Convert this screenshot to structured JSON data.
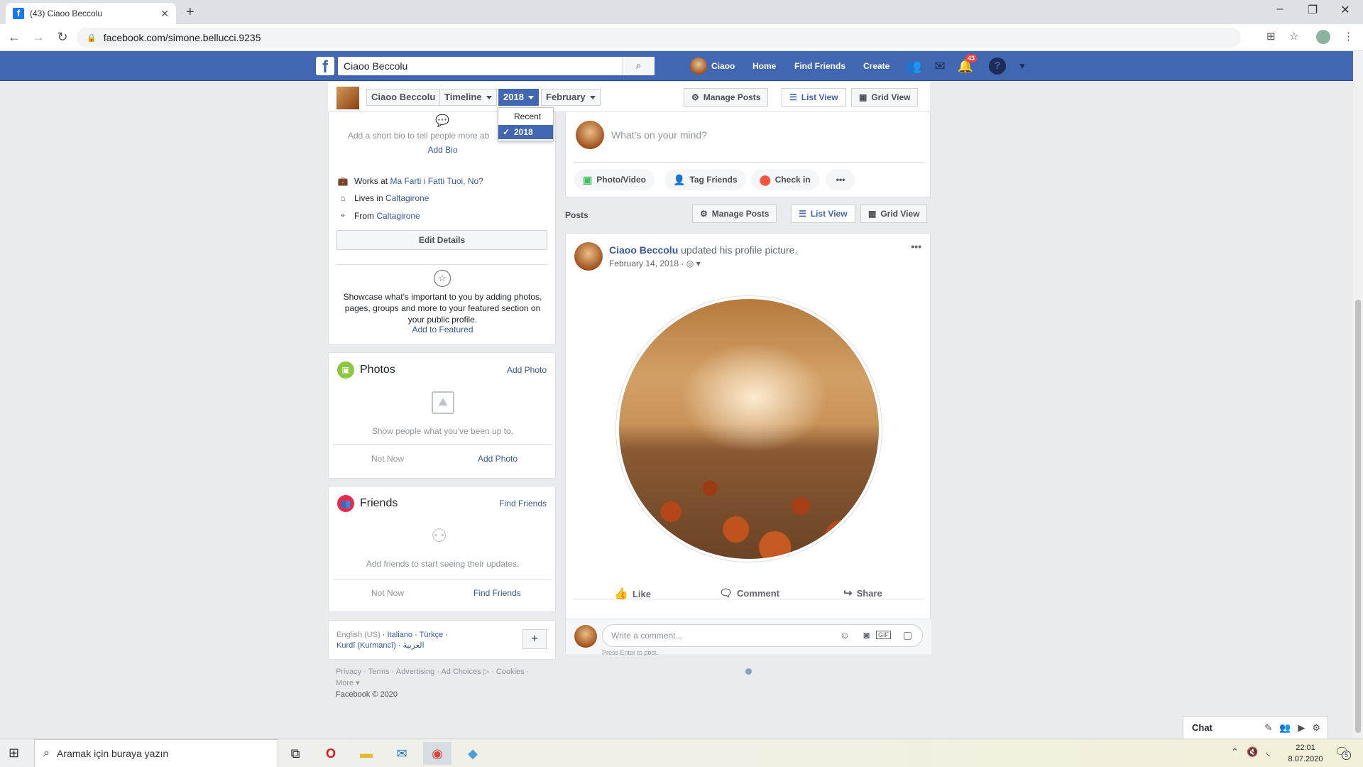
{
  "browser": {
    "tab_title": "(43) Ciaoo Beccolu",
    "url": "facebook.com/simone.bellucci.9235"
  },
  "fb_header": {
    "search_value": "Ciaoo Beccolu",
    "profile_name": "Ciaoo",
    "nav": [
      "Home",
      "Find Friends",
      "Create"
    ],
    "notification_count": "43"
  },
  "timeline_bar": {
    "name": "Ciaoo Beccolu",
    "timeline_label": "Timeline",
    "year_label": "2018",
    "month_label": "February",
    "manage_posts": "Manage Posts",
    "list_view": "List View",
    "grid_view": "Grid View",
    "dropdown": [
      "Recent",
      "2018"
    ]
  },
  "intro": {
    "bio_prompt": "Add a short bio to tell people more about",
    "add_bio": "Add Bio",
    "works_at_prefix": "Works at",
    "works_at": "Ma Farti i Fatti Tuoi, No?",
    "lives_in_prefix": "Lives in",
    "lives_in": "Caltagirone",
    "from_prefix": "From",
    "from": "Caltagirone",
    "edit_details": "Edit Details",
    "featured_text": "Showcase what's important to you by adding photos, pages, groups and more to your featured section on your public profile.",
    "add_featured": "Add to Featured"
  },
  "photos": {
    "title": "Photos",
    "add_photo_link": "Add Photo",
    "empty_text": "Show people what you've been up to.",
    "not_now": "Not Now",
    "add_photo": "Add Photo"
  },
  "friends": {
    "title": "Friends",
    "find_friends_link": "Find Friends",
    "empty_text": "Add friends to start seeing their updates.",
    "not_now": "Not Now",
    "find_friends": "Find Friends"
  },
  "languages": {
    "current": "English (US)",
    "others": [
      "Italiano",
      "Türkçe",
      "Kurdî (Kurmancî)",
      "العربية"
    ]
  },
  "footer": {
    "links": [
      "Privacy",
      "Terms",
      "Advertising",
      "Ad Choices",
      "Cookies",
      "More"
    ],
    "copyright": "Facebook © 2020"
  },
  "composer": {
    "placeholder": "What's on your mind?",
    "actions": [
      "Photo/Video",
      "Tag Friends",
      "Check in"
    ]
  },
  "posts_bar": {
    "label": "Posts",
    "manage_posts": "Manage Posts",
    "list_view": "List View",
    "grid_view": "Grid View"
  },
  "post": {
    "author": "Ciaoo Beccolu",
    "action": "updated his profile picture.",
    "date": "February 14, 2018",
    "like": "Like",
    "comment": "Comment",
    "share": "Share",
    "comment_placeholder": "Write a comment...",
    "comment_hint": "Press Enter to post."
  },
  "chat": {
    "label": "Chat"
  },
  "taskbar": {
    "search_placeholder": "Aramak için buraya yazın",
    "time": "22:01",
    "date": "8.07.2020",
    "notif_count": "5"
  },
  "colors": {
    "fb_blue": "#4267b2",
    "link": "#385898",
    "bg": "#e9ebee"
  }
}
